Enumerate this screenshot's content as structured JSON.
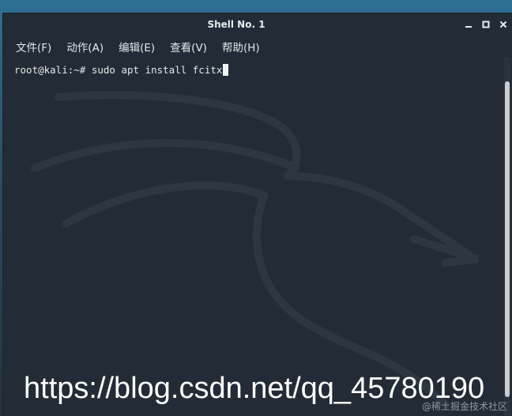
{
  "window": {
    "title": "Shell No. 1",
    "controls": [
      "minimize",
      "maximize",
      "close"
    ]
  },
  "menu": {
    "items": [
      {
        "label": "文件(F)"
      },
      {
        "label": "动作(A)"
      },
      {
        "label": "编辑(E)"
      },
      {
        "label": "查看(V)"
      },
      {
        "label": "帮助(H)"
      }
    ]
  },
  "terminal": {
    "prompt": "root@kali:~# ",
    "command": "sudo apt install fcitx",
    "background_logo": "kali-dragon-icon"
  },
  "overlay": {
    "url": "https://blog.csdn.net/qq_45780190",
    "credit": "@稀土掘金技术社区"
  },
  "colors": {
    "window_bg": "#232c36",
    "text": "#e6e6e6",
    "accent": "#c9ccd0"
  }
}
